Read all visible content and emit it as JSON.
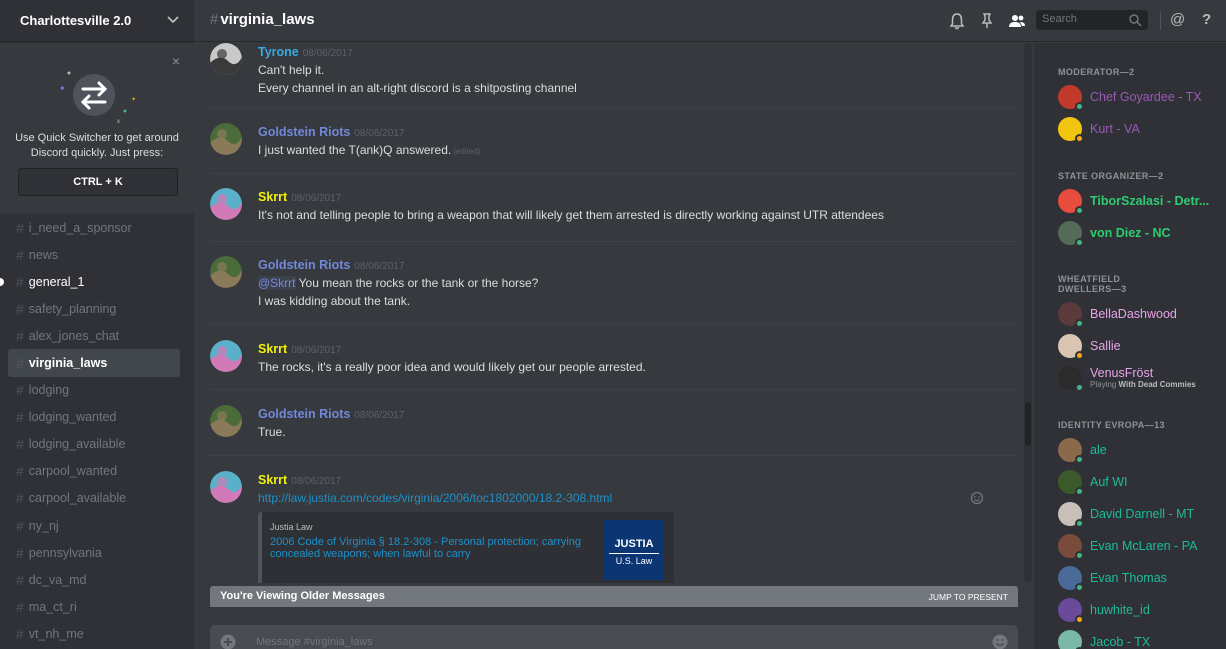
{
  "guild": {
    "name": "Charlottesville 2.0"
  },
  "quick_switcher": {
    "close": "×",
    "text": "Use Quick Switcher to get around Discord quickly. Just press:",
    "key": "CTRL + K"
  },
  "channels": [
    {
      "name": "i_need_a_sponsor",
      "state": "normal"
    },
    {
      "name": "news",
      "state": "normal"
    },
    {
      "name": "general_1",
      "state": "unread"
    },
    {
      "name": "safety_planning",
      "state": "normal"
    },
    {
      "name": "alex_jones_chat",
      "state": "normal"
    },
    {
      "name": "virginia_laws",
      "state": "active"
    },
    {
      "name": "lodging",
      "state": "normal"
    },
    {
      "name": "lodging_wanted",
      "state": "normal"
    },
    {
      "name": "lodging_available",
      "state": "normal"
    },
    {
      "name": "carpool_wanted",
      "state": "normal"
    },
    {
      "name": "carpool_available",
      "state": "normal"
    },
    {
      "name": "ny_nj",
      "state": "normal"
    },
    {
      "name": "pennsylvania",
      "state": "normal"
    },
    {
      "name": "dc_va_md",
      "state": "normal"
    },
    {
      "name": "ma_ct_ri",
      "state": "normal"
    },
    {
      "name": "vt_nh_me",
      "state": "normal"
    }
  ],
  "header": {
    "hash": "#",
    "channel": "virginia_laws",
    "search_placeholder": "Search",
    "icons": [
      "bell-icon",
      "pin-icon",
      "members-icon",
      "search-icon",
      "mention-icon",
      "help-icon"
    ],
    "mention": "@",
    "help": "?"
  },
  "messages": [
    {
      "author": "Tyrone",
      "color": "#3ba9e0",
      "timestamp": "08/06/2017",
      "lines": [
        "Can't help it.",
        "Every channel in an alt-right discord is a shitposting channel"
      ]
    },
    {
      "author": "Goldstein Riots",
      "color": "#7289da",
      "timestamp": "08/06/2017",
      "lines": [
        "I just wanted the T(ank)Q answered."
      ],
      "edited": "(edited)"
    },
    {
      "author": "Skrrt",
      "color": "#f1f10a",
      "timestamp": "08/06/2017",
      "lines": [
        "It's not and telling people to bring a weapon that will likely get them arrested is directly working against UTR attendees"
      ]
    },
    {
      "author": "Goldstein Riots",
      "color": "#7289da",
      "timestamp": "08/06/2017",
      "mention": "@Skrrt",
      "lines": [
        "You mean the rocks or the tank or the horse?",
        "I was kidding about the tank."
      ]
    },
    {
      "author": "Skrrt",
      "color": "#f1f10a",
      "timestamp": "08/06/2017",
      "lines": [
        "The rocks, it's a really poor idea and would likely get our people arrested."
      ]
    },
    {
      "author": "Goldstein Riots",
      "color": "#7289da",
      "timestamp": "08/06/2017",
      "lines": [
        "True."
      ]
    },
    {
      "author": "Skrrt",
      "color": "#f1f10a",
      "timestamp": "08/06/2017",
      "link": "http://law.justia.com/codes/virginia/2006/toc1802000/18.2-308.html",
      "embed": {
        "provider": "Justia Law",
        "title": "2006 Code of Virginia § 18.2-308 - Personal protection; carrying concealed weapons; when lawful to carry",
        "thumb_top": "JUSTIA",
        "thumb_bottom": "U.S. Law"
      }
    }
  ],
  "older_bar": {
    "text": "You're Viewing Older Messages",
    "jump": "JUMP TO PRESENT"
  },
  "composer": {
    "placeholder": "Message #virginia_laws"
  },
  "roles": [
    {
      "title": "MODERATOR—2",
      "members": [
        {
          "name": "Chef Goyardee - TX",
          "color": "#9b59b6",
          "status": "#43b581"
        },
        {
          "name": "Kurt - VA",
          "color": "#9b59b6",
          "status": "#faa61a"
        }
      ]
    },
    {
      "title": "STATE ORGANIZER—2",
      "members": [
        {
          "name": "TiborSzalasi - Detr...",
          "color": "#2ecc71",
          "status": "#43b581",
          "bold": true
        },
        {
          "name": "von Diez - NC",
          "color": "#2ecc71",
          "status": "#43b581",
          "bold": true
        }
      ]
    },
    {
      "title": "WHEATFIELD DWELLERS—3",
      "members": [
        {
          "name": "BellaDashwood",
          "color": "#e8a3e8",
          "status": "#43b581"
        },
        {
          "name": "Sallie",
          "color": "#e8a3e8",
          "status": "#faa61a"
        },
        {
          "name": "VenusFröst",
          "color": "#e8a3e8",
          "status": "#43b581",
          "game_prefix": "Playing",
          "game": "With Dead Commies"
        }
      ]
    },
    {
      "title": "IDENTITY EVROPA—13",
      "members": [
        {
          "name": "ale",
          "color": "#1abc9c",
          "status": "#43b581"
        },
        {
          "name": "Auf WI",
          "color": "#1abc9c",
          "status": "#43b581"
        },
        {
          "name": "David Darnell - MT",
          "color": "#1abc9c",
          "status": "#43b581"
        },
        {
          "name": "Evan McLaren - PA",
          "color": "#1abc9c",
          "status": "#43b581"
        },
        {
          "name": "Evan Thomas",
          "color": "#1abc9c",
          "status": "#43b581"
        },
        {
          "name": "huwhite_id",
          "color": "#1abc9c",
          "status": "#faa61a"
        },
        {
          "name": "Jacob - TX",
          "color": "#1abc9c",
          "status": "#43b581"
        }
      ]
    }
  ]
}
